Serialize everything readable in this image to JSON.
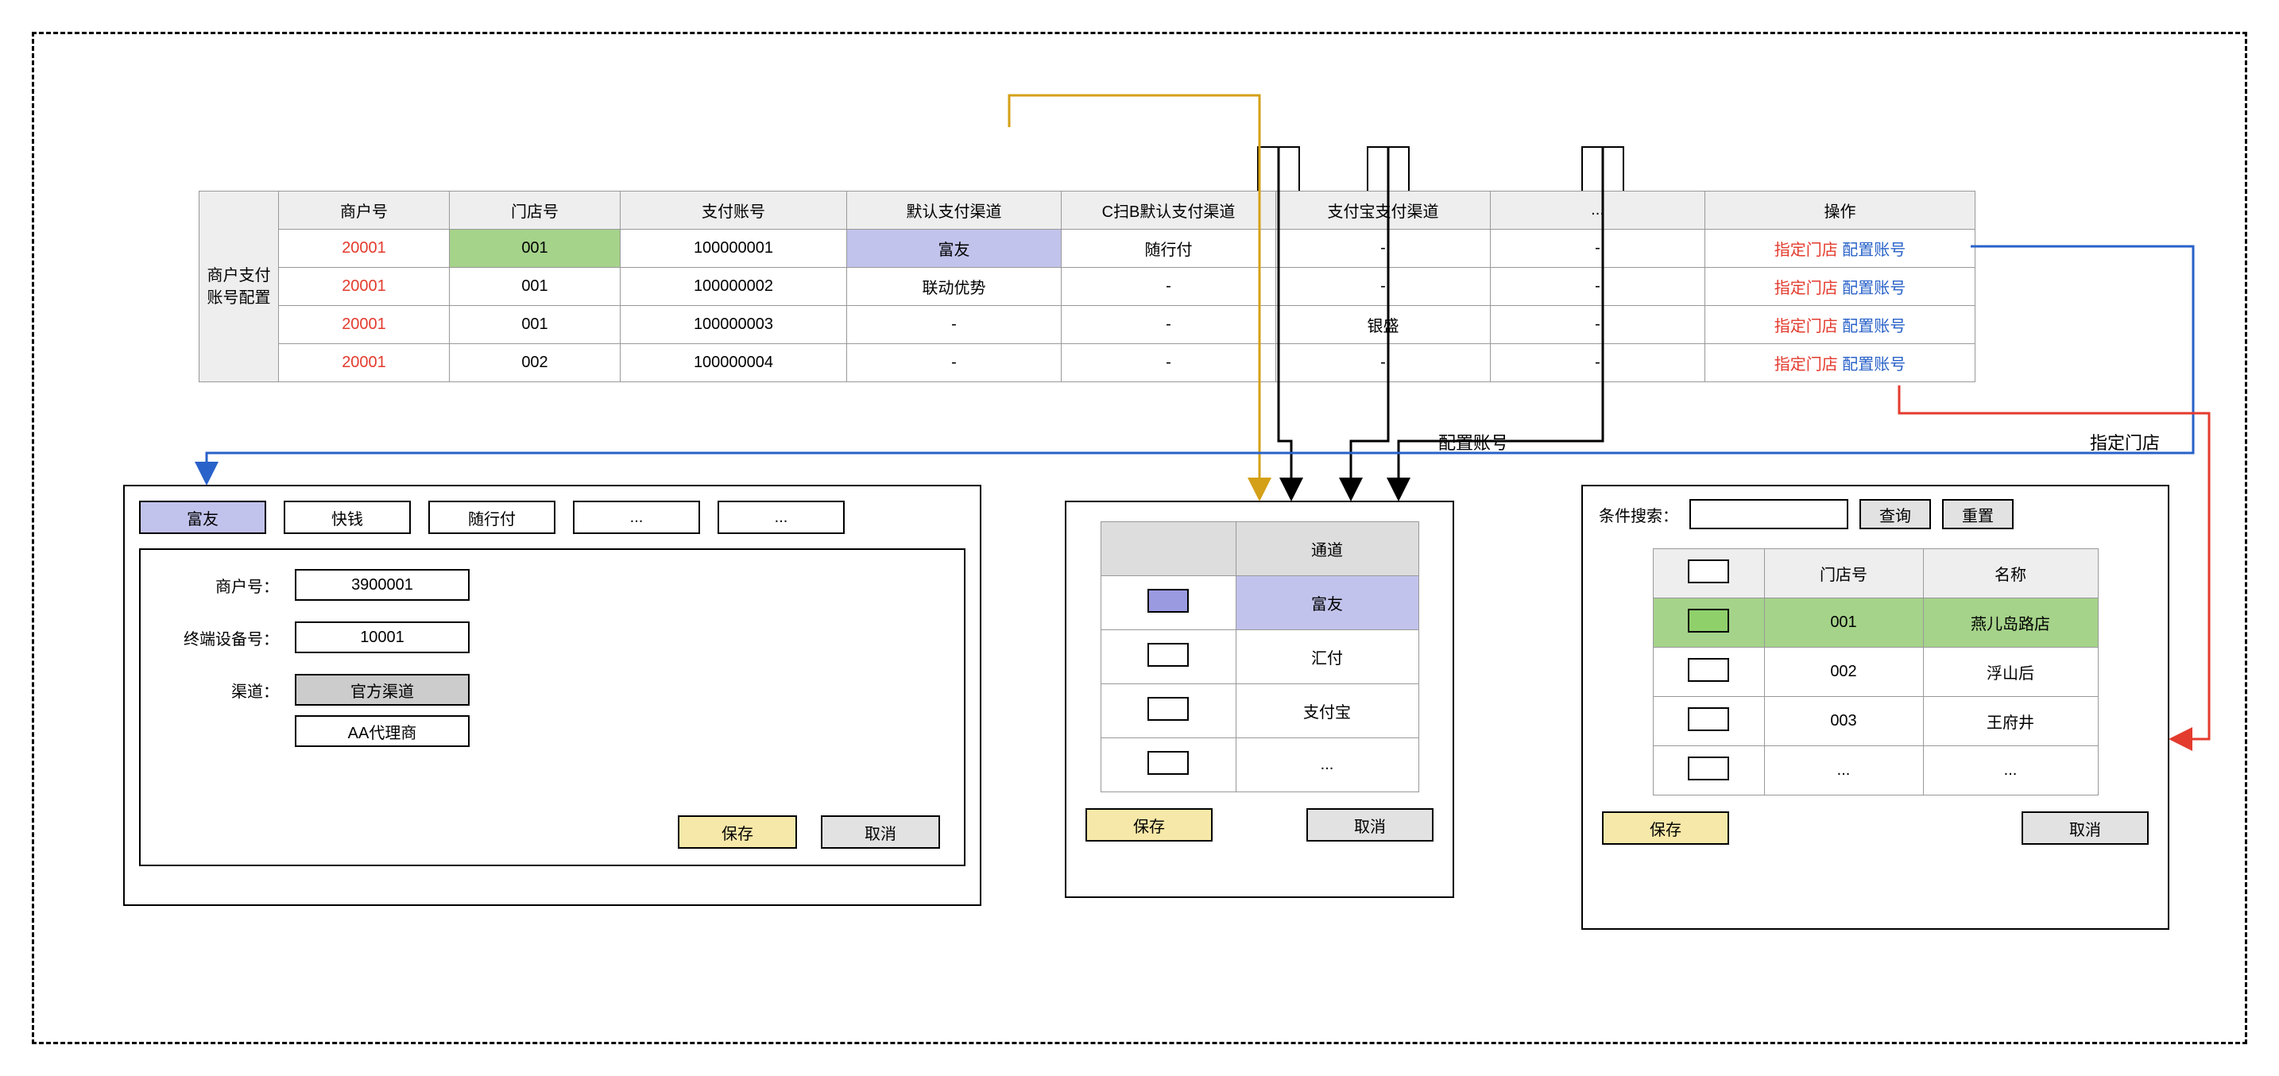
{
  "main": {
    "rowhead": "商户支付账号配置",
    "headers": [
      "商户号",
      "门店号",
      "支付账号",
      "默认支付渠道",
      "C扫B默认支付渠道",
      "支付宝支付渠道",
      "...",
      "操作"
    ],
    "op_link1": "指定门店",
    "op_link2": "配置账号",
    "rows": [
      {
        "merchant": "20001",
        "store": "001",
        "account": "100000001",
        "ch": "富友",
        "cb": "随行付",
        "ali": "-",
        "etc": "-",
        "store_hl": true,
        "ch_hl": true
      },
      {
        "merchant": "20001",
        "store": "001",
        "account": "100000002",
        "ch": "联动优势",
        "cb": "-",
        "ali": "-",
        "etc": "-"
      },
      {
        "merchant": "20001",
        "store": "001",
        "account": "100000003",
        "ch": "-",
        "cb": "-",
        "ali": "银盛",
        "etc": "-"
      },
      {
        "merchant": "20001",
        "store": "002",
        "account": "100000004",
        "ch": "-",
        "cb": "-",
        "ali": "-",
        "etc": "-"
      }
    ]
  },
  "flow": {
    "config_label": "配置账号",
    "assign_label": "指定门店"
  },
  "left": {
    "tabs": [
      "富友",
      "快钱",
      "随行付",
      "...",
      "..."
    ],
    "merchant_label": "商户号：",
    "merchant_value": "3900001",
    "terminal_label": "终端设备号：",
    "terminal_value": "10001",
    "channel_label": "渠道：",
    "channel_opts": [
      "官方渠道",
      "AA代理商"
    ],
    "save": "保存",
    "cancel": "取消"
  },
  "mid": {
    "headers": [
      "",
      "通道"
    ],
    "rows": [
      {
        "sel": "lilac",
        "name": "富友",
        "hl": true
      },
      {
        "sel": "",
        "name": "汇付"
      },
      {
        "sel": "",
        "name": "支付宝"
      },
      {
        "sel": "",
        "name": "..."
      }
    ],
    "save": "保存",
    "cancel": "取消"
  },
  "right": {
    "search_label": "条件搜索：",
    "query": "查询",
    "reset": "重置",
    "headers": [
      "",
      "门店号",
      "名称"
    ],
    "rows": [
      {
        "sel": "green",
        "code": "001",
        "name": "燕儿岛路店",
        "hl": true
      },
      {
        "sel": "",
        "code": "002",
        "name": "浮山后"
      },
      {
        "sel": "",
        "code": "003",
        "name": "王府井"
      },
      {
        "sel": "",
        "code": "...",
        "name": "..."
      }
    ],
    "save": "保存",
    "cancel": "取消"
  }
}
